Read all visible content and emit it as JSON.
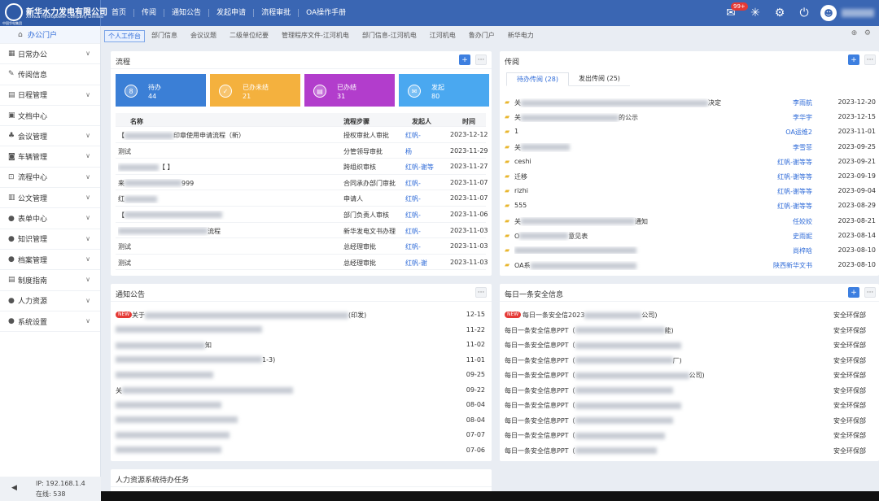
{
  "app": {
    "logo_cn": "新华水力发电有限公司",
    "logo_en": "Xinhua Hydropower Company Limited",
    "logo_sub": "中国华电集团"
  },
  "topnav": [
    "首页",
    "传阅",
    "通知公告",
    "发起申请",
    "流程审批",
    "OA操作手册"
  ],
  "header": {
    "badge": "99+"
  },
  "sidebar": {
    "items": [
      {
        "label": "办公门户",
        "active": true
      },
      {
        "label": "日常办公",
        "chev": true
      },
      {
        "label": "传阅信息"
      },
      {
        "label": "日程管理",
        "chev": true
      },
      {
        "label": "文档中心"
      },
      {
        "label": "会议管理",
        "chev": true
      },
      {
        "label": "车辆管理",
        "chev": true
      },
      {
        "label": "流程中心",
        "chev": true
      },
      {
        "label": "公文管理",
        "chev": true
      },
      {
        "label": "表单中心",
        "chev": true
      },
      {
        "label": "知识管理",
        "chev": true
      },
      {
        "label": "档案管理",
        "chev": true
      },
      {
        "label": "制度指南",
        "chev": true
      },
      {
        "label": "人力资源",
        "chev": true
      },
      {
        "label": "系统设置",
        "chev": true
      }
    ],
    "ip": "IP: 192.168.1.4",
    "online": "在线: 538"
  },
  "tabs": [
    "个人工作台",
    "部门信息",
    "会议议题",
    "二级单位纪要",
    "管理程序文件-江河机电",
    "部门信息-江河机电",
    "江河机电",
    "鲁办门户",
    "新华电力"
  ],
  "flow": {
    "title": "流程",
    "cards": [
      {
        "label": "待办",
        "count": "44",
        "color": "#3b7fd6",
        "icon": "8"
      },
      {
        "label": "已办未结",
        "count": "21",
        "color": "#f4b13e",
        "icon": "✓"
      },
      {
        "label": "已办结",
        "count": "31",
        "color": "#b23dcc",
        "icon": "▤"
      },
      {
        "label": "发起",
        "count": "80",
        "color": "#4aa8f0",
        "icon": "✉"
      }
    ],
    "headers": [
      "名称",
      "流程步骤",
      "发起人",
      "时间"
    ],
    "rows": [
      {
        "name": "【",
        "name2": "印章使用申请流程（新）",
        "step": "授权审批人审批",
        "starter": "红帆-",
        "date": "2023-12-12"
      },
      {
        "name": "测试",
        "name2": "",
        "step": "分管领导审批",
        "starter": "杨",
        "date": "2023-11-29"
      },
      {
        "name": "",
        "name2": "【 】",
        "step": "跨组织审核",
        "starter": "红帆-谢等",
        "date": "2023-11-27"
      },
      {
        "name": "来",
        "name2": "999",
        "step": "合同承办部门审批",
        "starter": "红帆-",
        "date": "2023-11-07"
      },
      {
        "name": "红",
        "name2": "",
        "step": "申请人",
        "starter": "红帆-",
        "date": "2023-11-07"
      },
      {
        "name": "【",
        "name2": "",
        "step": "部门负责人审核",
        "starter": "红帆-",
        "date": "2023-11-06"
      },
      {
        "name": "",
        "name2": "流程",
        "step": "新华发电文书办理",
        "starter": "红帆-",
        "date": "2023-11-03"
      },
      {
        "name": "测试",
        "name2": "",
        "step": "总经理审批",
        "starter": "红帆-",
        "date": "2023-11-03"
      },
      {
        "name": "测试",
        "name2": "",
        "step": "总经理审批",
        "starter": "红帆-谢",
        "date": "2023-11-03"
      }
    ]
  },
  "circulate": {
    "title": "传阅",
    "tabs": [
      "待办传阅 (28)",
      "发出传阅 (25)"
    ],
    "rows": [
      {
        "t": "关",
        "t2": "决定",
        "s": "李雨航",
        "d": "2023-12-20"
      },
      {
        "t": "关",
        "t2": "的公示",
        "s": "李华宇",
        "d": "2023-12-15"
      },
      {
        "t": "1",
        "t2": "",
        "s": "OA运维2",
        "d": "2023-11-01"
      },
      {
        "t": "关",
        "t2": "",
        "s": "李雪菲",
        "d": "2023-09-25"
      },
      {
        "t": "ceshi",
        "t2": "",
        "s": "红帆-谢等等",
        "d": "2023-09-21"
      },
      {
        "t": "迁移",
        "t2": "",
        "s": "红帆-谢等等",
        "d": "2023-09-19"
      },
      {
        "t": "rizhi",
        "t2": "",
        "s": "红帆-谢等等",
        "d": "2023-09-04"
      },
      {
        "t": "555",
        "t2": "",
        "s": "红帆-谢等等",
        "d": "2023-08-29"
      },
      {
        "t": "关",
        "t2": "通知",
        "s": "任姣姣",
        "d": "2023-08-21"
      },
      {
        "t": "O",
        "t2": "意见表",
        "s": "史雨妮",
        "d": "2023-08-14"
      },
      {
        "t": "",
        "t2": "",
        "s": "尚梓晗",
        "d": "2023-08-10"
      },
      {
        "t": "OA系",
        "t2": "",
        "s": "陕西新华文书",
        "d": "2023-08-10"
      }
    ]
  },
  "notice": {
    "title": "通知公告",
    "new_label": "NEW",
    "rows": [
      {
        "new": true,
        "t": "关于",
        "t2": "(印发)",
        "d": "12-15"
      },
      {
        "new": false,
        "t": "",
        "t2": "",
        "d": "11-22"
      },
      {
        "new": false,
        "t": "",
        "t2": "知",
        "d": "11-02"
      },
      {
        "new": false,
        "t": "",
        "t2": "1-3)",
        "d": "11-01"
      },
      {
        "new": false,
        "t": "",
        "t2": "",
        "d": "09-25"
      },
      {
        "new": false,
        "t": "关",
        "t2": "",
        "d": "09-22"
      },
      {
        "new": false,
        "t": "",
        "t2": "",
        "d": "08-04"
      },
      {
        "new": false,
        "t": "",
        "t2": "",
        "d": "08-04"
      },
      {
        "new": false,
        "t": "",
        "t2": "",
        "d": "07-07"
      },
      {
        "new": false,
        "t": "",
        "t2": "",
        "d": "07-06"
      }
    ]
  },
  "safety": {
    "title": "每日一条安全信息",
    "new_label": "NEW",
    "rows": [
      {
        "new": true,
        "t": "每日一条安全信",
        "t2": "2023",
        "t3": "公司)",
        "d": "安全环保部"
      },
      {
        "new": false,
        "t": "每日一条安全信息PPT（",
        "t2": "",
        "t3": "能)",
        "d": "安全环保部"
      },
      {
        "new": false,
        "t": "每日一条安全信息PPT（",
        "t2": "",
        "t3": "",
        "d": "安全环保部"
      },
      {
        "new": false,
        "t": "每日一条安全信息PPT（",
        "t2": "",
        "t3": "厂)",
        "d": "安全环保部"
      },
      {
        "new": false,
        "t": "每日一条安全信息PPT（",
        "t2": "",
        "t3": "公司)",
        "d": "安全环保部"
      },
      {
        "new": false,
        "t": "每日一条安全信息PPT（",
        "t2": "",
        "t3": "",
        "d": "安全环保部"
      },
      {
        "new": false,
        "t": "每日一条安全信息PPT（",
        "t2": "",
        "t3": "",
        "d": "安全环保部"
      },
      {
        "new": false,
        "t": "每日一条安全信息PPT（",
        "t2": "",
        "t3": "",
        "d": "安全环保部"
      },
      {
        "new": false,
        "t": "每日一条安全信息PPT（",
        "t2": "",
        "t3": "",
        "d": "安全环保部"
      },
      {
        "new": false,
        "t": "每日一条安全信息PPT（",
        "t2": "",
        "t3": "",
        "d": "安全环保部"
      }
    ]
  },
  "hr": {
    "title": "人力资源系统待办任务"
  }
}
